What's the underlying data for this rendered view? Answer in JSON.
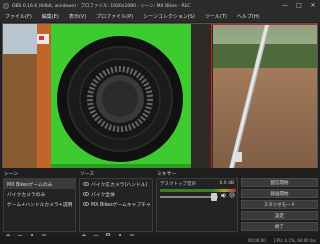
{
  "window": {
    "title": "OBS 0.16.6 (64bit, windows) - プロファイル: 1920x1080 - シーン: MX Bikes - REC",
    "minimize": "—",
    "maximize": "□",
    "close": "✕"
  },
  "menu": {
    "items": [
      "ファイル(F)",
      "編集(E)",
      "表示(V)",
      "プロファイル(P)",
      "シーンコレクション(S)",
      "ツール(T)",
      "ヘルプ(H)"
    ]
  },
  "docks": {
    "scenes_title": "シーン",
    "sources_title": "ソース",
    "mixer_title": "ミキサー"
  },
  "scenes": [
    "MX Bikesゲームのみ",
    "バイクカメラのみ",
    "ゲーム+ハンドルカメラ+説明"
  ],
  "sources": [
    "バイク広カメラ(ハンドル)",
    "バイク全体",
    "MX Bikesゲームキャプチャ"
  ],
  "mixer": {
    "track_name": "デスクトップ音声",
    "track_db": "0.0 dB"
  },
  "controls": [
    "配信開始",
    "録画開始",
    "スタジオモード",
    "設定",
    "終了"
  ],
  "toolbar_icons": {
    "add": "+",
    "remove": "−",
    "up": "∧",
    "down": "∨",
    "gear": "⚙"
  },
  "status": {
    "time": "00:00:00",
    "cpu": "CPU: 0.1%, 60.00 fps"
  }
}
